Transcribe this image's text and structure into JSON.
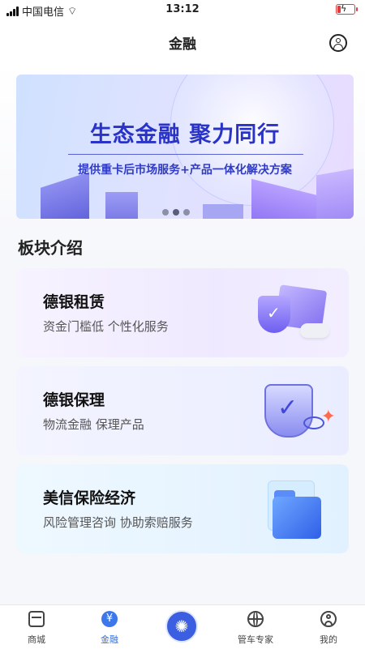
{
  "status_bar": {
    "carrier": "中国电信",
    "time": "13:12"
  },
  "header": {
    "title": "金融"
  },
  "banner": {
    "title": "生态金融 聚力同行",
    "subtitle": "提供重卡后市场服务+产品一体化解决方案",
    "slide_count": 3,
    "active_slide": 1
  },
  "section": {
    "title": "板块介绍"
  },
  "cards": [
    {
      "title": "德银租赁",
      "desc": "资金门槛低 个性化服务"
    },
    {
      "title": "德银保理",
      "desc": "物流金融 保理产品"
    },
    {
      "title": "美信保险经济",
      "desc": "风险管理咨询 协助索赔服务"
    }
  ],
  "tabbar": {
    "items": [
      {
        "label": "商城",
        "icon": "shop-icon"
      },
      {
        "label": "金融",
        "icon": "finance-icon",
        "active": true
      },
      {
        "label": "",
        "icon": "center-logo-icon"
      },
      {
        "label": "管车专家",
        "icon": "globe-icon"
      },
      {
        "label": "我的",
        "icon": "user-icon"
      }
    ]
  },
  "colors": {
    "accent": "#2f6fe8",
    "banner_text": "#2a33c8"
  }
}
